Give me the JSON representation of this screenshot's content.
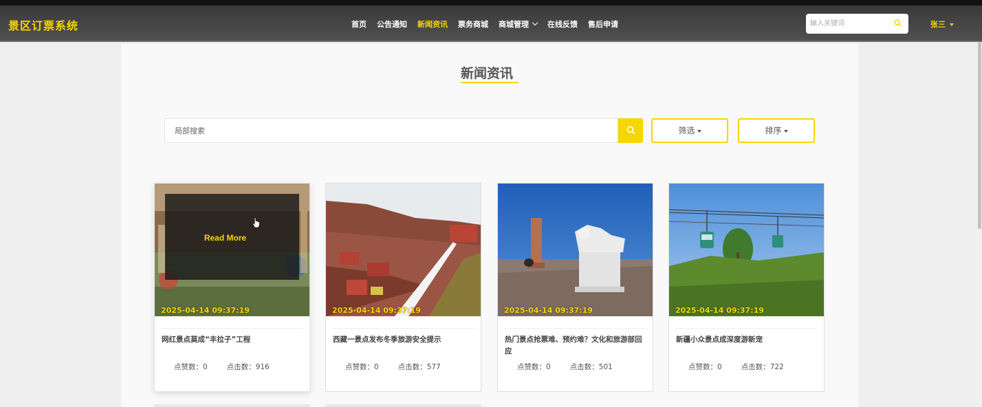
{
  "app": {
    "brand": "景区订票系统"
  },
  "nav": {
    "items": [
      {
        "label": "首页",
        "active": false,
        "dropdown": false
      },
      {
        "label": "公告通知",
        "active": false,
        "dropdown": false
      },
      {
        "label": "新闻资讯",
        "active": true,
        "dropdown": false
      },
      {
        "label": "票务商城",
        "active": false,
        "dropdown": false
      },
      {
        "label": "商城管理",
        "active": false,
        "dropdown": true
      },
      {
        "label": "在线反馈",
        "active": false,
        "dropdown": false
      },
      {
        "label": "售后申请",
        "active": false,
        "dropdown": false
      }
    ],
    "search_placeholder": "输入关键词",
    "user": "张三"
  },
  "page": {
    "title": "新闻资讯",
    "search_placeholder": "局部搜索",
    "filter_label": "筛选",
    "sort_label": "排序"
  },
  "cards": [
    {
      "date": "2025-04-14 09:37:19",
      "title": "网红景点莫成“丰拉子”工程",
      "likes_label": "点赞数：",
      "likes": "0",
      "clicks_label": "点击数：",
      "clicks": "916",
      "overlay": "Read More"
    },
    {
      "date": "2025-04-14 09:37:19",
      "title": "西藏一景点发布冬季旅游安全提示",
      "likes_label": "点赞数：",
      "likes": "0",
      "clicks_label": "点击数：",
      "clicks": "577"
    },
    {
      "date": "2025-04-14 09:37:19",
      "title": "热门景点抢票难、预约难？文化和旅游部回应",
      "likes_label": "点赞数：",
      "likes": "0",
      "clicks_label": "点击数：",
      "clicks": "501"
    },
    {
      "date": "2025-04-14 09:37:19",
      "title": "新疆小众景点成深度游新宠",
      "likes_label": "点赞数：",
      "likes": "0",
      "clicks_label": "点击数：",
      "clicks": "722"
    }
  ],
  "colors": {
    "accent": "#f6d600",
    "navbar": "#454545",
    "background": "#efefef"
  },
  "icons": {
    "search": "search-icon",
    "dropdown": "chevron-down-icon",
    "cursor": "hand-cursor-icon"
  }
}
